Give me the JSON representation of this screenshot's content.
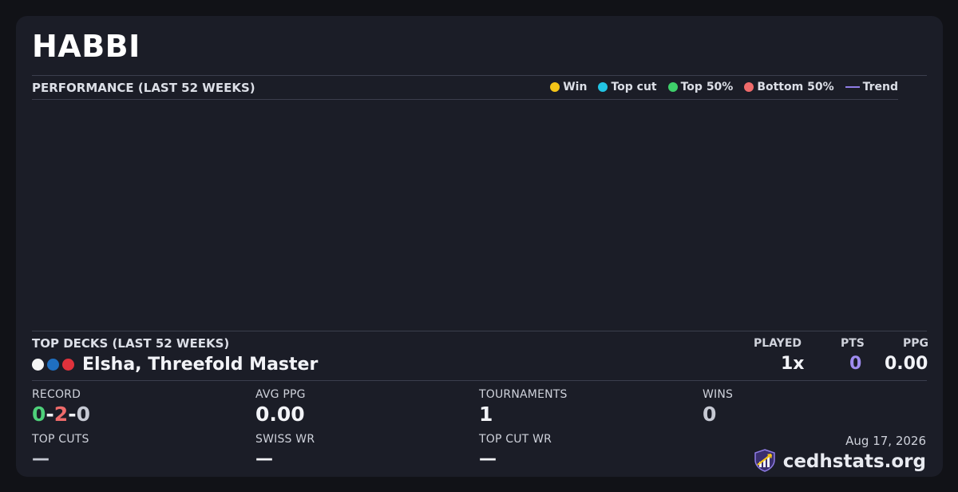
{
  "player": {
    "name": "HABBI"
  },
  "performance": {
    "label": "PERFORMANCE (LAST 52 WEEKS)",
    "legend": [
      {
        "label": "Win",
        "color": "#f5c518",
        "kind": "dot"
      },
      {
        "label": "Top cut",
        "color": "#22c4e4",
        "kind": "dot"
      },
      {
        "label": "Top 50%",
        "color": "#3ecf6a",
        "kind": "dot"
      },
      {
        "label": "Bottom 50%",
        "color": "#ef6b6b",
        "kind": "dot"
      },
      {
        "label": "Trend",
        "color": "#8f7ce6",
        "kind": "line"
      }
    ]
  },
  "top_decks": {
    "label": "TOP DECKS (LAST 52 WEEKS)",
    "columns": {
      "played": "PLAYED",
      "pts": "PTS",
      "ppg": "PPG"
    },
    "decks": [
      {
        "name": "Elsha, Threefold Master",
        "color_pips": [
          "#f4f4f4",
          "#1f6fc0",
          "#e0323c"
        ],
        "played": "1x",
        "pts": "0",
        "ppg": "0.00"
      }
    ]
  },
  "stats": {
    "record": {
      "label": "RECORD",
      "wins": "0",
      "losses": "2",
      "draws": "0",
      "sep": "-"
    },
    "avg_ppg": {
      "label": "AVG PPG",
      "value": "0.00"
    },
    "tournaments": {
      "label": "TOURNAMENTS",
      "value": "1"
    },
    "wins": {
      "label": "WINS",
      "value": "0"
    },
    "top_cuts": {
      "label": "TOP CUTS",
      "value": "—"
    },
    "swiss_wr": {
      "label": "SWISS WR",
      "value": "—"
    },
    "top_cut_wr": {
      "label": "TOP CUT WR",
      "value": "—"
    }
  },
  "footer": {
    "date": "Aug 17, 2026",
    "brand": "cedhstats.org",
    "brand_icon": "chart-shield-icon"
  },
  "colors": {
    "win_green": "#4ed07a",
    "loss_red": "#ef6b6b",
    "draw_gray": "#c6c9d3",
    "pts_purple": "#9f8cf0",
    "muted_value": "#c6c9d3"
  }
}
